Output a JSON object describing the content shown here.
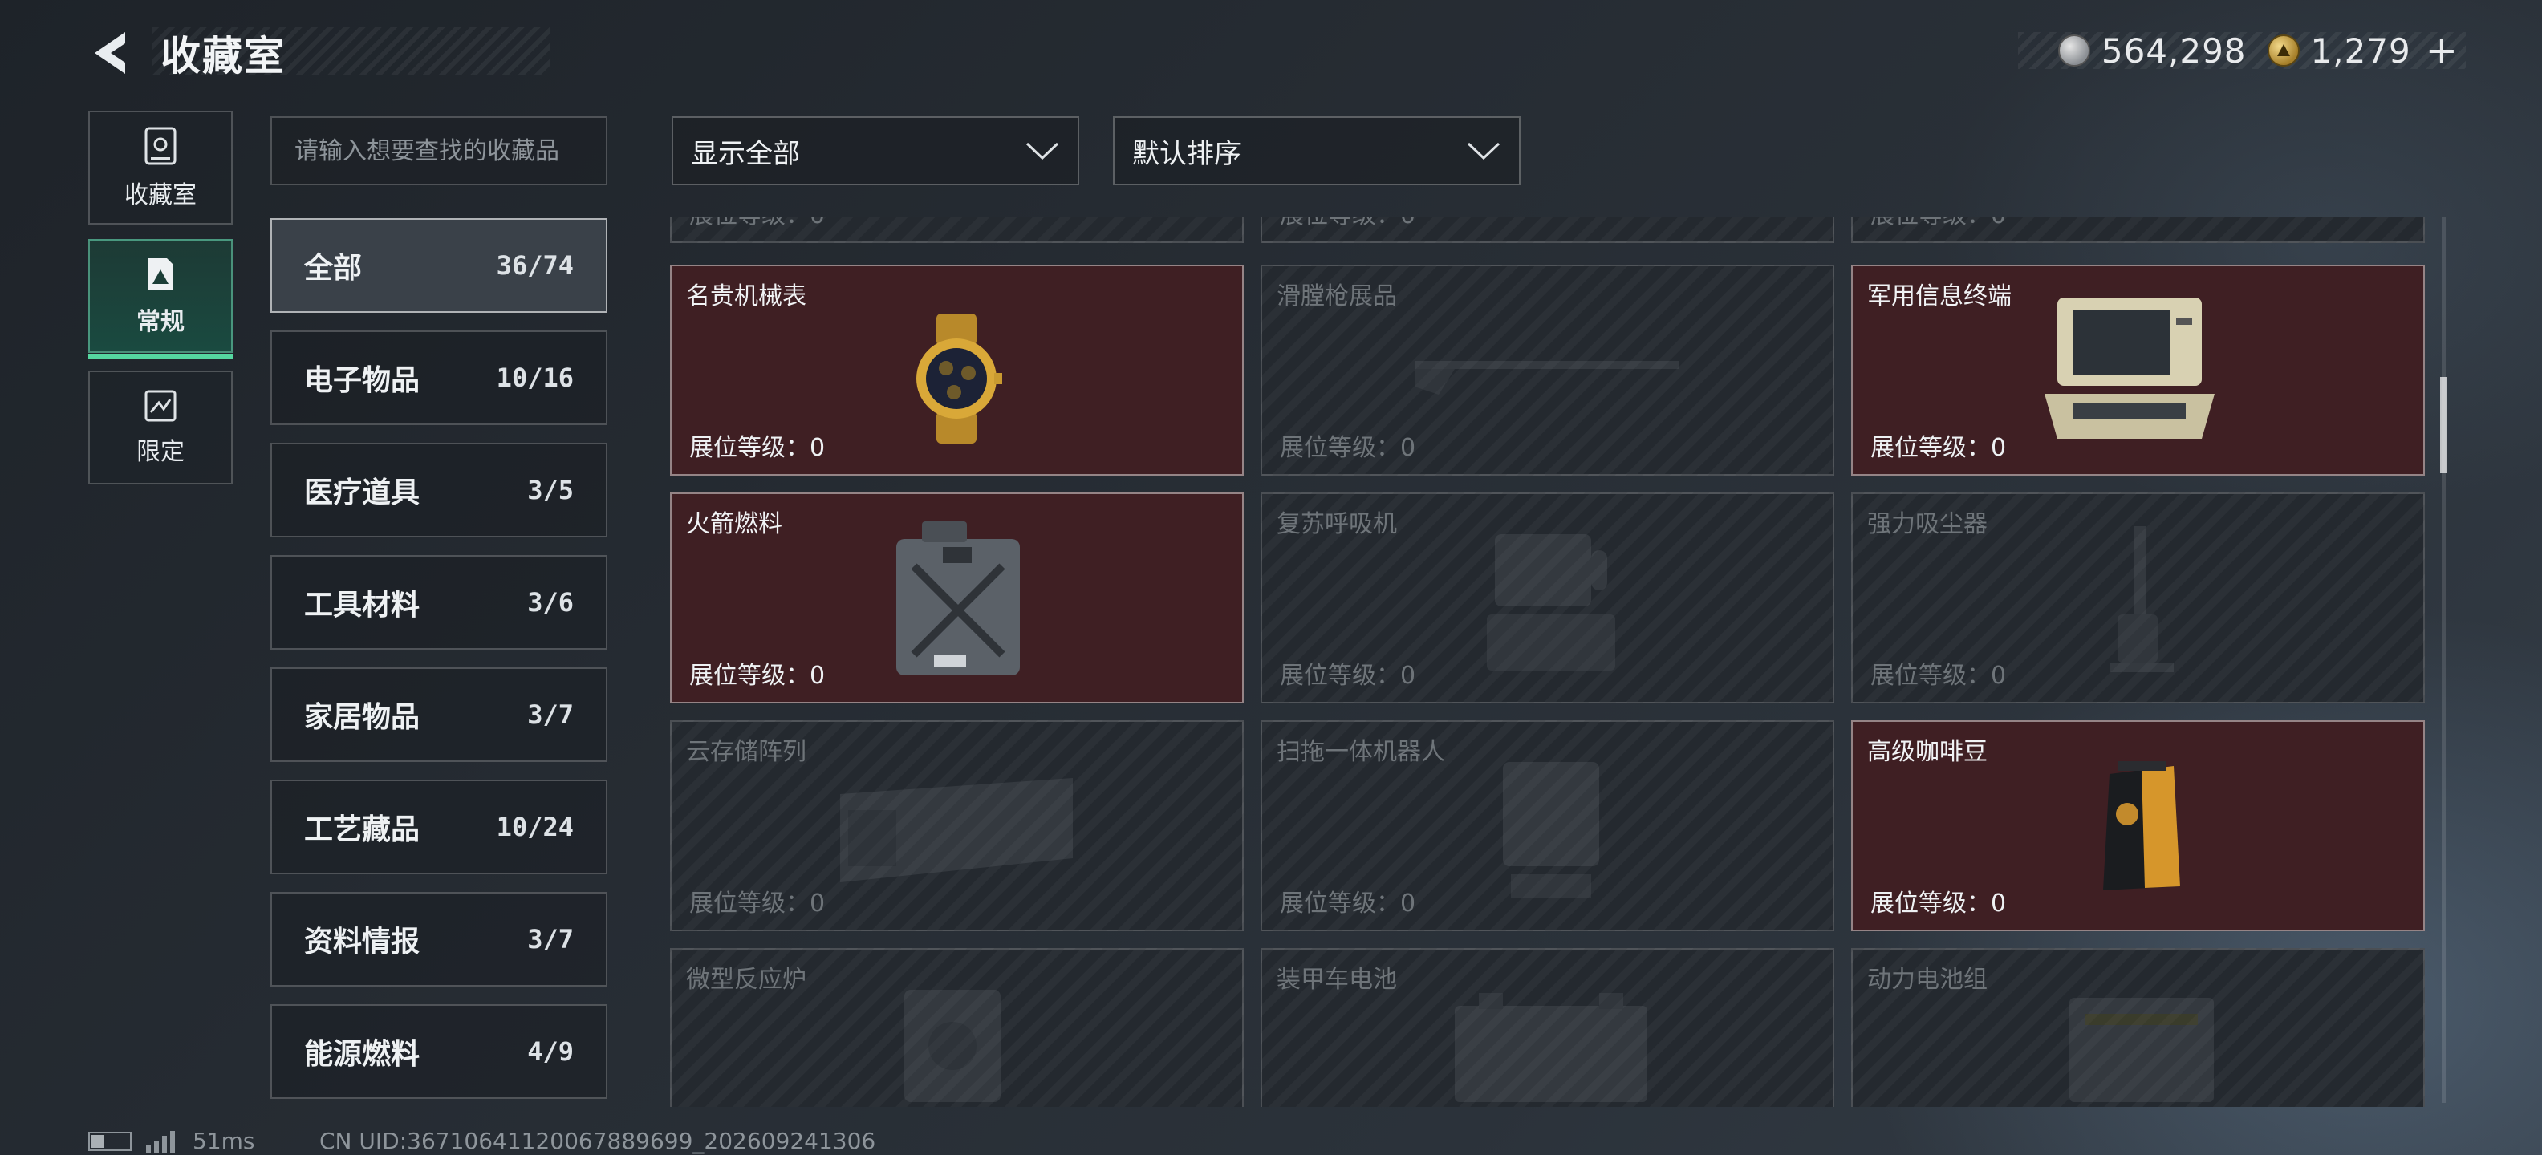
{
  "header": {
    "title": "收藏室",
    "currency": [
      {
        "icon": "silver-coin-icon",
        "value": "564,298"
      },
      {
        "icon": "gold-coin-icon",
        "value": "1,279"
      }
    ],
    "add_label": "+"
  },
  "side_tabs": [
    {
      "label": "收藏室",
      "icon": "vault-icon"
    },
    {
      "label": "常规",
      "icon": "regular-icon",
      "active": true
    },
    {
      "label": "限定",
      "icon": "limited-icon"
    }
  ],
  "search": {
    "placeholder": "请输入想要查找的收藏品"
  },
  "categories": [
    {
      "name": "全部",
      "count": "36/74",
      "active": true
    },
    {
      "name": "电子物品",
      "count": "10/16"
    },
    {
      "name": "医疗道具",
      "count": "3/5"
    },
    {
      "name": "工具材料",
      "count": "3/6"
    },
    {
      "name": "家居物品",
      "count": "3/7"
    },
    {
      "name": "工艺藏品",
      "count": "10/24"
    },
    {
      "name": "资料情报",
      "count": "3/7"
    },
    {
      "name": "能源燃料",
      "count": "4/9"
    }
  ],
  "filters": {
    "show": "显示全部",
    "sort": "默认排序"
  },
  "level_label": "展位等级：0",
  "items": [
    {
      "name": "",
      "owned": false
    },
    {
      "name": "",
      "owned": false
    },
    {
      "name": "",
      "owned": false
    },
    {
      "name": "名贵机械表",
      "owned": true
    },
    {
      "name": "滑膛枪展品",
      "owned": false
    },
    {
      "name": "军用信息终端",
      "owned": true
    },
    {
      "name": "火箭燃料",
      "owned": true
    },
    {
      "name": "复苏呼吸机",
      "owned": false
    },
    {
      "name": "强力吸尘器",
      "owned": false
    },
    {
      "name": "云存储阵列",
      "owned": false
    },
    {
      "name": "扫拖一体机器人",
      "owned": false
    },
    {
      "name": "高级咖啡豆",
      "owned": true
    },
    {
      "name": "微型反应炉",
      "owned": false
    },
    {
      "name": "装甲车电池",
      "owned": false
    },
    {
      "name": "动力电池组",
      "owned": false
    }
  ],
  "status": {
    "ping": "51ms",
    "uid": "CN UID:3671064112006788969​9_202609241306"
  }
}
